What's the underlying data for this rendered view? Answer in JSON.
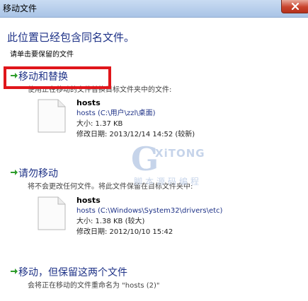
{
  "window": {
    "title": "移动文件"
  },
  "dialog": {
    "heading": "此位置已经包含同名文件。",
    "subheading": "请单击要保留的文件"
  },
  "options": [
    {
      "title": "移动和替换",
      "description": "使用正在移动的文件替换目标文件夹中的文件:",
      "file": {
        "name": "hosts",
        "path": "hosts (C:\\用户\\zzl\\桌面)",
        "size": "大小: 1.37 KB",
        "modified": "修改日期: 2013/12/14 14:52 (较新)"
      }
    },
    {
      "title": "请勿移动",
      "description": "将不会更改任何文件。将此文件保留在目标文件夹中:",
      "file": {
        "name": "hosts",
        "path": "hosts (C:\\Windows\\System32\\drivers\\etc)",
        "size": "大小: 1.38 KB (较大)",
        "modified": "修改日期: 2012/10/10 15:42"
      }
    },
    {
      "title": "移动，但保留这两个文件",
      "description": "会将正在移动的文件重命名为 \"hosts (2)\""
    }
  ],
  "watermark": {
    "logo_letter": "G",
    "brand": "XiTONG",
    "tagline": "脚本源码编程"
  },
  "colors": {
    "link_blue": "#1e3287",
    "arrow_green": "#2e9d2c",
    "highlight_red": "#e0161b",
    "close_red": "#c9432c"
  },
  "icons": {
    "option_arrow": "green-arrow-icon",
    "file": "blank-document-icon",
    "close": "close-icon"
  }
}
